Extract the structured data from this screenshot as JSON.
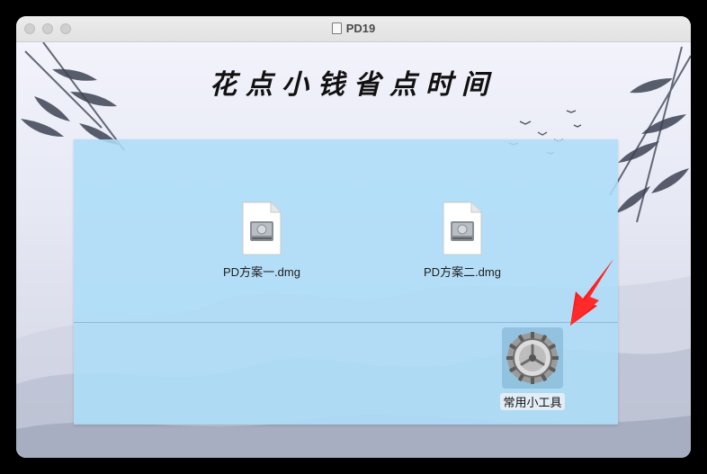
{
  "window": {
    "title": "PD19"
  },
  "banner": {
    "heading": "花点小钱省点时间"
  },
  "files": [
    {
      "name": "PD方案一.dmg",
      "icon": "disk-image-icon"
    },
    {
      "name": "PD方案二.dmg",
      "icon": "disk-image-icon"
    }
  ],
  "tool": {
    "label": "常用小工具",
    "icon": "system-preferences-gear-icon"
  },
  "colors": {
    "panel": "#addcf8",
    "arrow": "#ff1a1a",
    "titlebar": "#e6e6e6"
  }
}
